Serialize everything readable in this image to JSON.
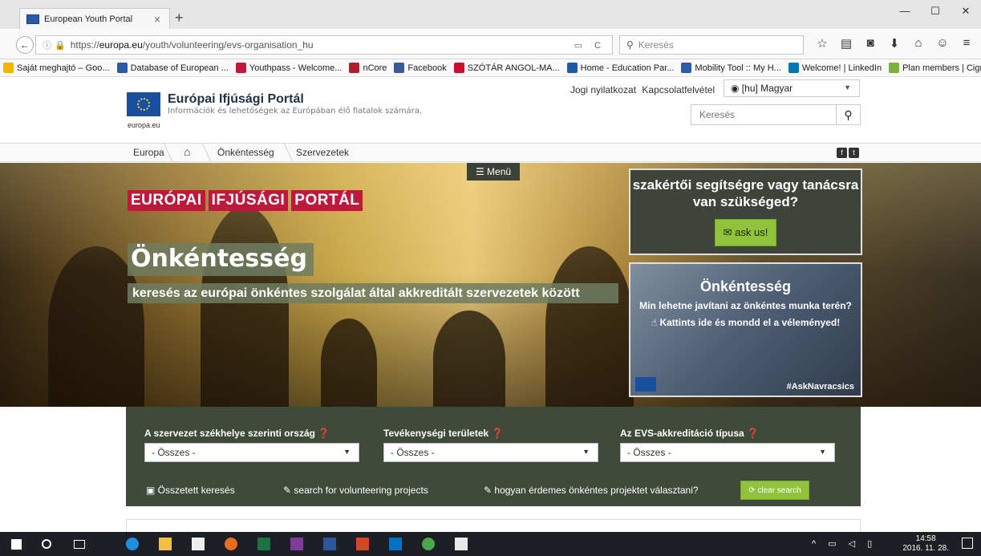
{
  "browser": {
    "tab_title": "European Youth Portal",
    "tab_close": "×",
    "new_tab": "+",
    "window_buttons": [
      "—",
      "☐",
      "✕"
    ],
    "url_prefix": "https://",
    "url_domain": "europa.eu",
    "url_path": "/youth/volunteering/evs-organisation_hu",
    "url_right_icons": "▭ C",
    "search_placeholder": "Keresés",
    "toolbar_icons": [
      "☆",
      "▤",
      "◙",
      "⬇",
      "⌂",
      "☺",
      "≡"
    ],
    "bookmarks": [
      {
        "label": "Saját meghajtó – Goo...",
        "color": "#f4b400"
      },
      {
        "label": "Database of European ...",
        "color": "#2a5ba8"
      },
      {
        "label": "Youthpass - Welcome...",
        "color": "#c0183a"
      },
      {
        "label": "nCore",
        "color": "#b0202a"
      },
      {
        "label": "Facebook",
        "color": "#3b5998"
      },
      {
        "label": "SZÓTÁR ANGOL-MA...",
        "color": "#c8102e"
      },
      {
        "label": "Home - Education Par...",
        "color": "#1f5aa6"
      },
      {
        "label": "Mobility Tool :: My H...",
        "color": "#2a5ba8"
      },
      {
        "label": "Welcome! | LinkedIn",
        "color": "#0077b5"
      },
      {
        "label": "Plan members | Cigna",
        "color": "#7bb33a"
      }
    ]
  },
  "header": {
    "top_links": [
      "Jogi nyilatkozat",
      "Kapcsolatfelvétel"
    ],
    "language": "◉ [hu] Magyar",
    "logo_title": "Európai Ifjúsági Portál",
    "logo_subtitle": "Információk és lehetőségek az Európában élő fiatalok számára.",
    "logo_domain": "europa.eu",
    "search_placeholder": "Keresés"
  },
  "breadcrumb": [
    "Europa",
    "⌂",
    "Önkéntesség",
    "Szervezetek"
  ],
  "hero": {
    "menu": "☰ Menü",
    "brand_words": [
      "EURÓPAI",
      "IFJÚSÁGI",
      "PORTÁL"
    ],
    "title": "Önkéntesség",
    "subtitle": "keresés az európai önkéntes szolgálat által akkreditált szervezetek között",
    "ask_question": "szakértői segítségre vagy tanácsra van szükséged?",
    "ask_button": "✉ ask us!",
    "vol_title": "Önkéntesség",
    "vol_question": "Min lehetne javítani az önkéntes munka terén?",
    "vol_cta": "☝ Kattints ide és mondd el a véleményed!",
    "vol_tag": "#AskNavracsics"
  },
  "filters": {
    "labels": [
      "A szervezet székhelye szerinti ország ❓",
      "Tevékenységi területek ❓",
      "Az EVS-akkreditáció típusa ❓"
    ],
    "values": [
      "- Összes -",
      "- Összes -",
      "- Összes -"
    ],
    "links": [
      "▣ Összetett keresés",
      "✎ search for volunteering projects",
      "✎ hogyan érdemes önkéntes projektet választani?"
    ],
    "clear": "⟳ clear search"
  },
  "taskbar": {
    "time": "14:58",
    "date": "2016. 11. 28.",
    "tray": "^ ▭ ◁ ▯"
  }
}
